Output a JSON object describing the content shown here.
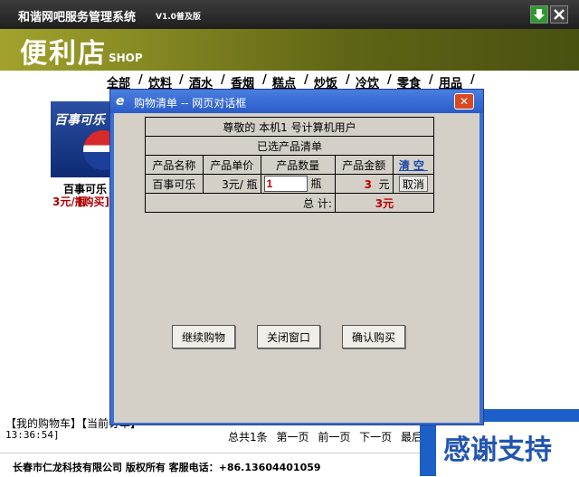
{
  "app": {
    "title": "和谐网吧服务管理系统",
    "version": "V1.0普及版"
  },
  "banner": {
    "shop_title": "便利店",
    "shop_sub": "SHOP"
  },
  "nav": [
    "全部",
    "饮料",
    "酒水",
    "香烟",
    "糕点",
    "炒饭",
    "冷饮",
    "零食",
    "用品"
  ],
  "product": {
    "image_text": "百事可乐",
    "name": "百事可乐",
    "price": "3元/瓶",
    "buy": "[购买]"
  },
  "cart_link": "【我的购物车】【当前订单】",
  "time": "13:36:54]",
  "pager": {
    "total": "总共1条",
    "first": "第一页",
    "prev": "前一页",
    "next": "下一页",
    "last": "最后一页"
  },
  "footer": {
    "company": "长春市仁龙科技有限公司 版权所有  客服电话：+86.13604401059"
  },
  "thanks": "感谢支持",
  "dialog": {
    "title": "购物清单 -- 网页对话框",
    "greeting": "尊敬的 本机1  号计算机用户",
    "list_title": "已选产品清单",
    "headers": {
      "name": "产品名称",
      "unit_price": "产品单价",
      "qty": "产品数量",
      "amount": "产品金额",
      "clear": "清空"
    },
    "row": {
      "name": "百事可乐",
      "unit_price": "3元/ 瓶",
      "qty": "1",
      "qty_unit": "瓶",
      "amount": "3",
      "amount_unit": "元",
      "cancel": "取消"
    },
    "total_label": "总  计:",
    "total_value": "3元",
    "buttons": {
      "continue": "继续购物",
      "close": "关闭窗口",
      "confirm": "确认购买"
    }
  }
}
